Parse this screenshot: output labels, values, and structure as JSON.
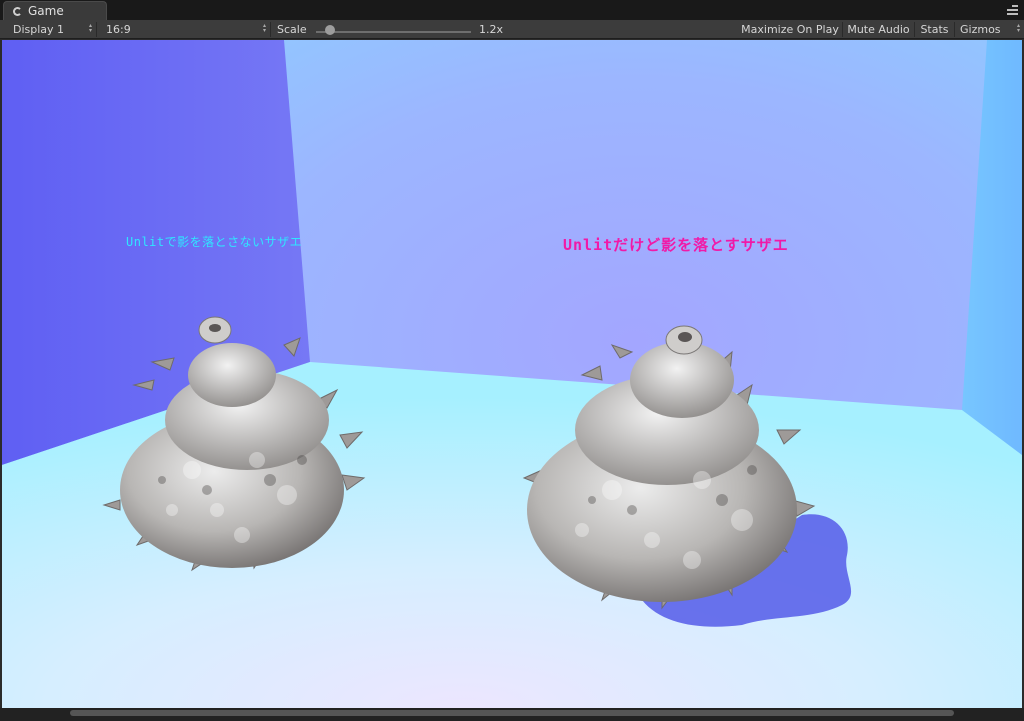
{
  "window": {
    "tab_label": "Game",
    "tab_icon": "pacman-game-icon",
    "menu_icon": "tab-menu-icon"
  },
  "toolbar": {
    "display": "Display 1",
    "aspect": "16:9",
    "scale_label": "Scale",
    "scale_value": "1.2x",
    "scale_fraction": 0.08,
    "maximize": "Maximize On Play",
    "mute": "Mute Audio",
    "stats": "Stats",
    "gizmos": "Gizmos"
  },
  "scene": {
    "label_left": "Unlitで影を落とさないサザエ",
    "label_right": "Unlitだけど影を落とすサザエ",
    "label_left_color": "#2fe6ff",
    "label_right_color": "#f01aa8",
    "wall_left_color": "#6f6cf2",
    "wall_back_color": "#9db4ff",
    "floor_color": "#c9f0ff",
    "shadow_color": "#5a62e8"
  }
}
